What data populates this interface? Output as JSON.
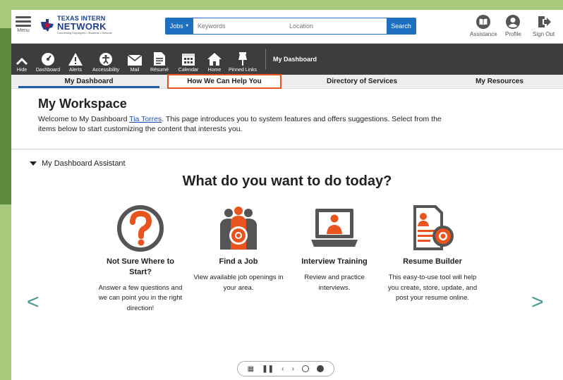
{
  "header": {
    "menu_label": "Menu",
    "logo_line1": "TEXAS INTERN",
    "logo_line2": "NETWORK",
    "logo_tagline": "Connecting Employers • Students • Schools",
    "search": {
      "category": "Jobs",
      "keyword_placeholder": "Keywords",
      "location_placeholder": "Location",
      "button_label": "Search"
    },
    "utility": [
      {
        "label": "Assistance",
        "icon": "book-icon"
      },
      {
        "label": "Profile",
        "icon": "user-icon"
      },
      {
        "label": "Sign Out",
        "icon": "sign-out-icon"
      }
    ]
  },
  "toolbar": {
    "items": [
      {
        "label": "Hide",
        "icon": "chevron-up-icon"
      },
      {
        "label": "Dashboard",
        "icon": "gauge-icon"
      },
      {
        "label": "Alerts",
        "icon": "warning-icon"
      },
      {
        "label": "Accessibility",
        "icon": "accessibility-icon"
      },
      {
        "label": "Mail",
        "icon": "mail-icon"
      },
      {
        "label": "Résumé",
        "icon": "document-icon"
      },
      {
        "label": "Calendar",
        "icon": "calendar-icon"
      },
      {
        "label": "Home",
        "icon": "home-icon"
      },
      {
        "label": "Pinned Links",
        "icon": "pin-icon"
      }
    ],
    "page_title": "My Dashboard"
  },
  "tabs": [
    {
      "label": "My Dashboard",
      "active": true
    },
    {
      "label": "How We Can Help You",
      "highlighted": true
    },
    {
      "label": "Directory of Services"
    },
    {
      "label": "My Resources"
    }
  ],
  "workspace": {
    "title": "My Workspace",
    "intro_before": "Welcome to My Dashboard ",
    "user_name": "Tia Torres",
    "intro_after": ". This page introduces you to system features and offers suggestions. Select from the items below to start customizing the content that interests you."
  },
  "assistant": {
    "heading": "My Dashboard Assistant",
    "question": "What do you want to do today?",
    "cards": [
      {
        "title": "Not Sure Where to Start?",
        "description": "Answer a few questions and we can point you in the right direction!",
        "icon": "question-icon"
      },
      {
        "title": "Find a Job",
        "description": "View available job openings in your area.",
        "icon": "job-search-icon"
      },
      {
        "title": "Interview Training",
        "description": "Review and practice interviews.",
        "icon": "interview-icon"
      },
      {
        "title": "Resume Builder",
        "description": "This easy-to-use tool will help you create, store, update, and post your resume online.",
        "icon": "resume-builder-icon"
      }
    ],
    "prev_arrow": "<",
    "next_arrow": ">"
  },
  "colors": {
    "brand_blue": "#1e6fbf",
    "toolbar_bg": "#3d3d3d",
    "highlight_orange": "#e8531e",
    "icon_orange": "#e8531e",
    "arrow_teal": "#4a9a91"
  }
}
